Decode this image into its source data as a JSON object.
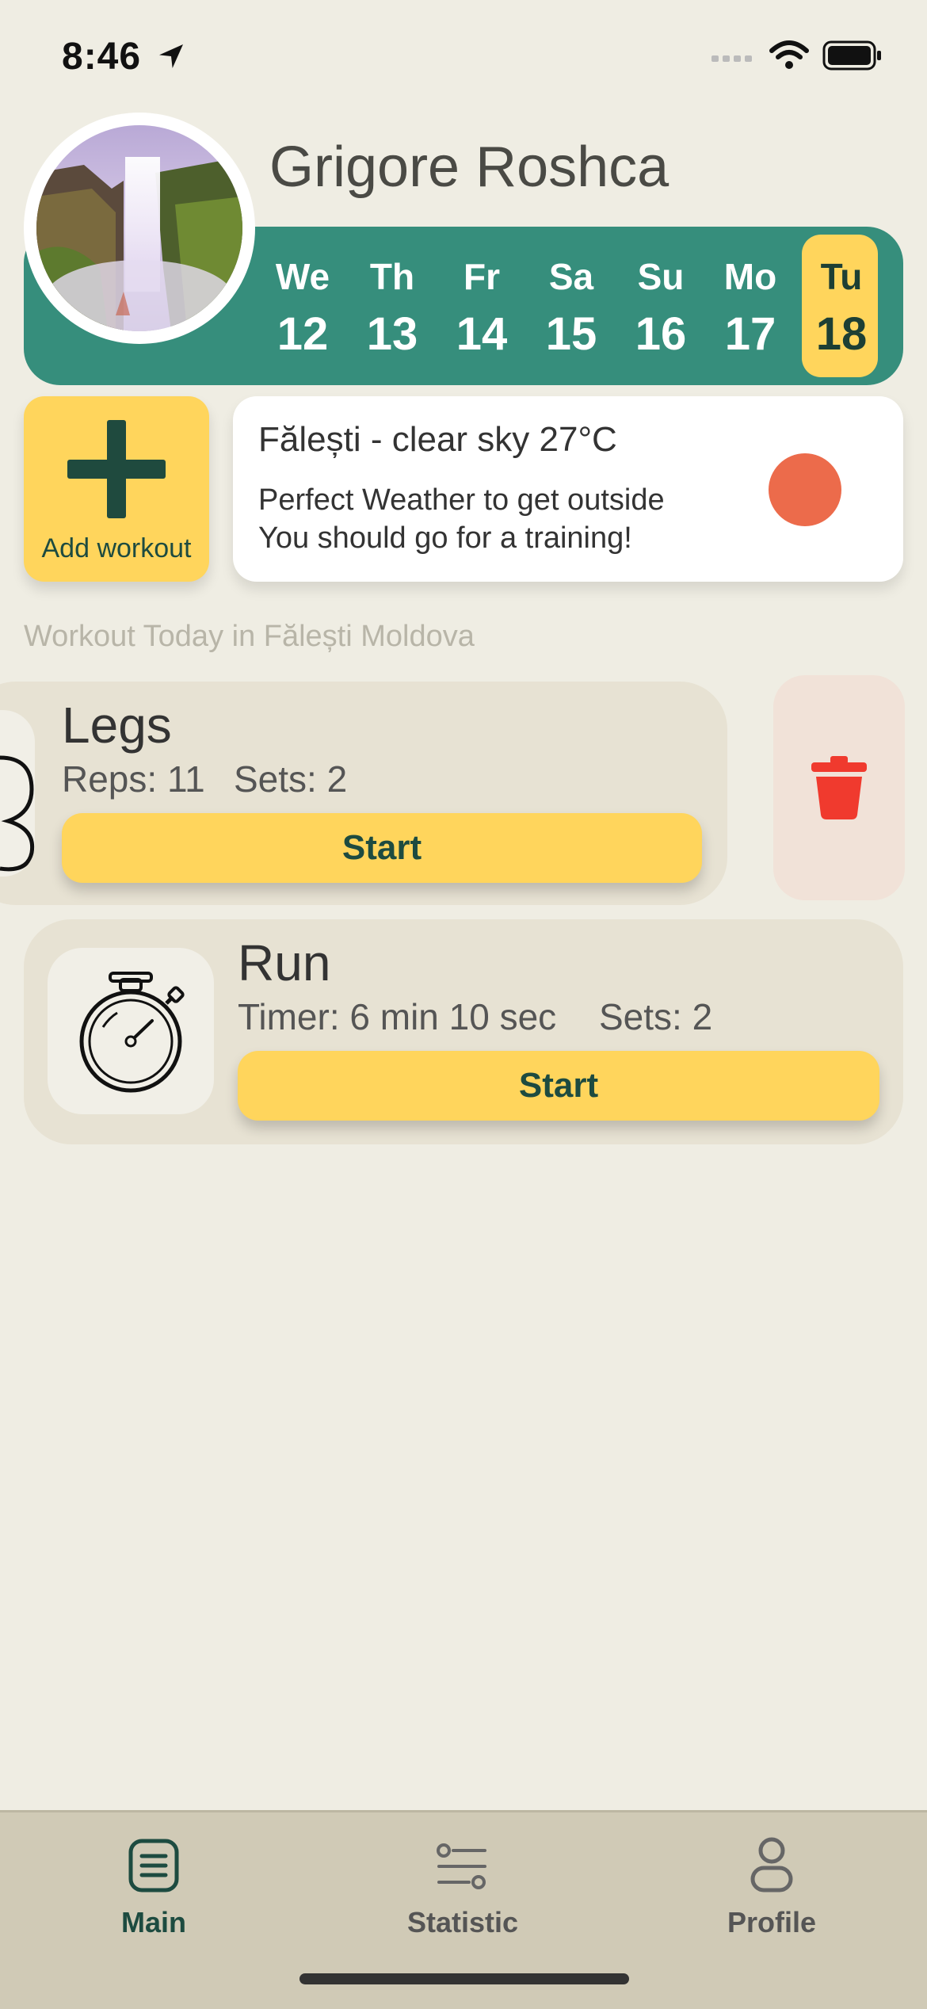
{
  "status_bar": {
    "time": "8:46"
  },
  "profile": {
    "name": "Grigore Roshca"
  },
  "days": [
    {
      "dow": "We",
      "num": "12",
      "active": false
    },
    {
      "dow": "Th",
      "num": "13",
      "active": false
    },
    {
      "dow": "Fr",
      "num": "14",
      "active": false
    },
    {
      "dow": "Sa",
      "num": "15",
      "active": false
    },
    {
      "dow": "Su",
      "num": "16",
      "active": false
    },
    {
      "dow": "Mo",
      "num": "17",
      "active": false
    },
    {
      "dow": "Tu",
      "num": "18",
      "active": true
    }
  ],
  "add_workout": {
    "label": "Add workout"
  },
  "weather": {
    "title": "Fălești - clear sky 27°C",
    "line1": "Perfect Weather to get outside",
    "line2": "You should go for a training!",
    "indicator_color": "#ec6b4b"
  },
  "section_label": "Workout Today in Fălești Moldova",
  "workouts": [
    {
      "title": "Legs",
      "reps": "Reps: 11",
      "sets": "Sets: 2",
      "button": "Start"
    },
    {
      "title": "Run",
      "timer": "Timer: 6 min 10 sec",
      "sets": "Sets: 2",
      "button": "Start"
    }
  ],
  "tabs": [
    {
      "label": "Main",
      "icon": "list-icon",
      "active": true
    },
    {
      "label": "Statistic",
      "icon": "sliders-icon",
      "active": false
    },
    {
      "label": "Profile",
      "icon": "person-icon",
      "active": false
    }
  ],
  "colors": {
    "accent": "#368e7c",
    "highlight": "#ffd55c",
    "background": "#efede3",
    "delete": "#f03a2e"
  }
}
